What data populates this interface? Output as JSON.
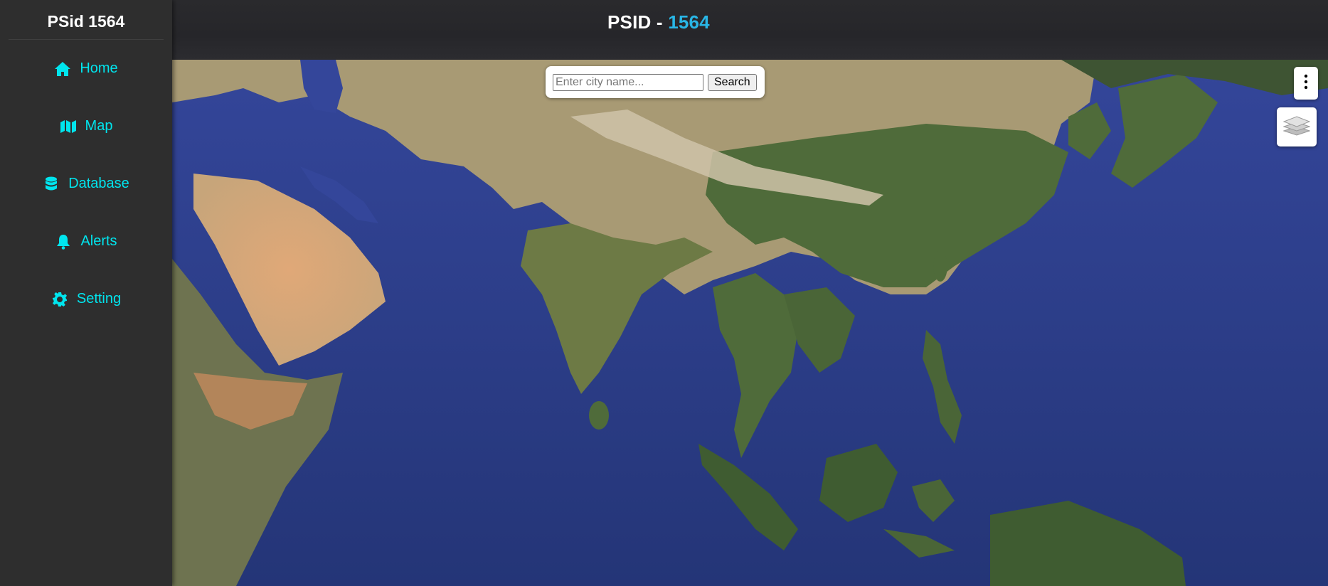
{
  "sidebar": {
    "brand": "PSid 1564",
    "items": [
      {
        "label": "Home",
        "icon": "home-icon"
      },
      {
        "label": "Map",
        "icon": "map-icon"
      },
      {
        "label": "Database",
        "icon": "database-icon"
      },
      {
        "label": "Alerts",
        "icon": "bell-icon"
      },
      {
        "label": "Setting",
        "icon": "gear-icon"
      }
    ]
  },
  "header": {
    "title_prefix": "PSID - ",
    "title_accent": "1564"
  },
  "map": {
    "search": {
      "placeholder": "Enter city name...",
      "value": "",
      "button_label": "Search"
    },
    "controls": {
      "more_icon": "vertical-dots-icon",
      "layers_icon": "layers-icon"
    }
  },
  "colors": {
    "sidebar_bg": "#2e2e2e",
    "nav_accent": "#00e5ee",
    "title_accent": "#29b6e6",
    "ocean": "#2c3e88"
  }
}
